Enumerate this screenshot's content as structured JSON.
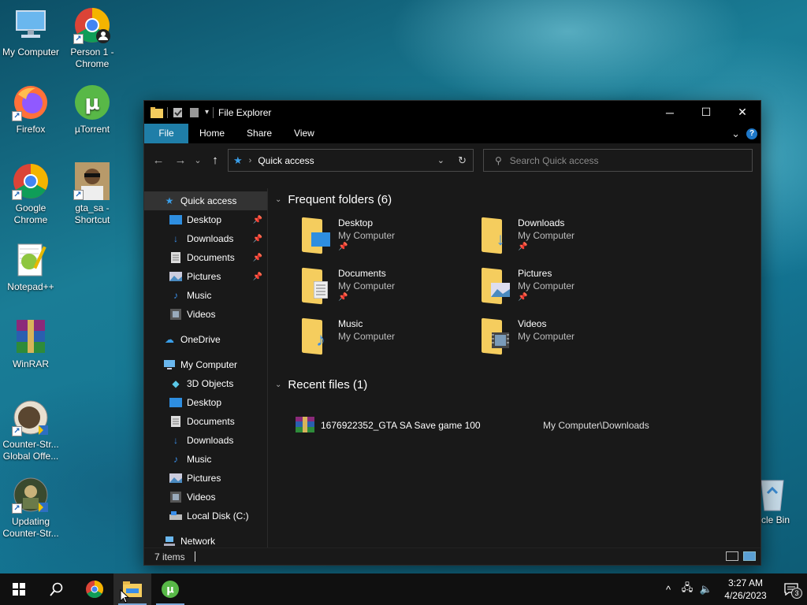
{
  "desktop": {
    "icons": [
      {
        "label": "My Computer",
        "icon": "monitor-icon"
      },
      {
        "label": "Person 1 - Chrome",
        "icon": "chrome-icon"
      },
      {
        "label": "Firefox",
        "icon": "firefox-icon"
      },
      {
        "label": "µTorrent",
        "icon": "utorrent-icon"
      },
      {
        "label": "Google Chrome",
        "icon": "chrome-icon"
      },
      {
        "label": "gta_sa - Shortcut",
        "icon": "gta-icon"
      },
      {
        "label": "Notepad++",
        "icon": "notepadpp-icon"
      },
      {
        "label": "WinRAR",
        "icon": "winrar-icon"
      },
      {
        "label": "Counter-Str... Global Offe...",
        "icon": "csgo-icon"
      },
      {
        "label": "Updating Counter-Str...",
        "icon": "csgo-update-icon"
      },
      {
        "label": "ycle Bin",
        "icon": "recycle-bin-icon"
      }
    ]
  },
  "window": {
    "title": "File Explorer",
    "controls": {
      "minimize": "─",
      "maximize": "☐",
      "close": "✕"
    }
  },
  "ribbon": {
    "tabs": [
      "File",
      "Home",
      "Share",
      "View"
    ],
    "expand_glyph": "⌄",
    "help_glyph": "?"
  },
  "navbar": {
    "back_glyph": "←",
    "forward_glyph": "→",
    "recent_glyph": "⌄",
    "up_glyph": "↑",
    "address_path": "Quick access",
    "search_placeholder": "Search Quick access"
  },
  "sidebar": {
    "quick_access": "Quick access",
    "quick_items": [
      {
        "label": "Desktop",
        "pinned": true
      },
      {
        "label": "Downloads",
        "pinned": true
      },
      {
        "label": "Documents",
        "pinned": true
      },
      {
        "label": "Pictures",
        "pinned": true
      },
      {
        "label": "Music",
        "pinned": false
      },
      {
        "label": "Videos",
        "pinned": false
      }
    ],
    "onedrive": "OneDrive",
    "my_computer": "My Computer",
    "computer_items": [
      "3D Objects",
      "Desktop",
      "Documents",
      "Downloads",
      "Music",
      "Pictures",
      "Videos",
      "Local Disk (C:)"
    ],
    "network": "Network"
  },
  "content": {
    "frequent_header": "Frequent folders (6)",
    "folders": [
      {
        "name": "Desktop",
        "location": "My Computer",
        "pinned": true,
        "overlay": "desktop"
      },
      {
        "name": "Downloads",
        "location": "My Computer",
        "pinned": true,
        "overlay": "downloads"
      },
      {
        "name": "Documents",
        "location": "My Computer",
        "pinned": true,
        "overlay": "documents"
      },
      {
        "name": "Pictures",
        "location": "My Computer",
        "pinned": true,
        "overlay": "pictures"
      },
      {
        "name": "Music",
        "location": "My Computer",
        "pinned": false,
        "overlay": "music"
      },
      {
        "name": "Videos",
        "location": "My Computer",
        "pinned": false,
        "overlay": "videos"
      }
    ],
    "recent_header": "Recent files (1)",
    "recent_files": [
      {
        "name": "1676922352_GTA SA Save game 100",
        "path": "My Computer\\Downloads"
      }
    ]
  },
  "statusbar": {
    "items_count": "7 items"
  },
  "taskbar": {
    "time": "3:27 AM",
    "date": "4/26/2023",
    "notification_count": "3",
    "tray_chevron": "^"
  },
  "colors": {
    "accent": "#1f7ea8",
    "folder": "#f5cd5e",
    "window_bg": "#191919",
    "titlebar_bg": "#000000"
  }
}
